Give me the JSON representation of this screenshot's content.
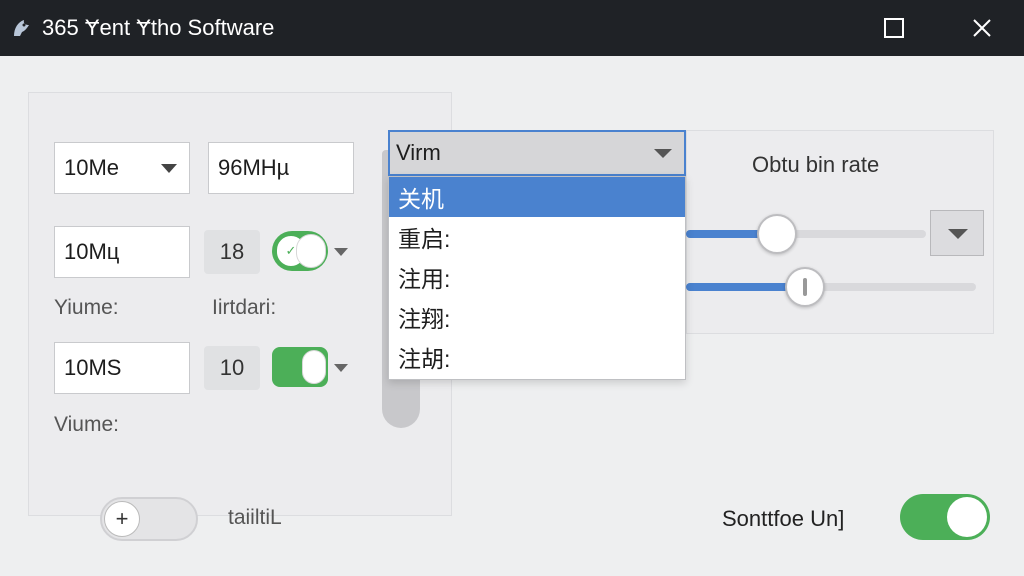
{
  "window": {
    "title": "365 Ɏent Ɏtho Software",
    "icon": "app-logo-icon",
    "maximize_icon": "maximize-icon",
    "close_icon": "close-icon"
  },
  "left_panel": {
    "row1": {
      "select_value": "10Me",
      "input_value": "96MHµ"
    },
    "row2": {
      "input_value": "10Mц",
      "badge": "18"
    },
    "row3": {
      "input_value": "10MS",
      "badge": "10"
    },
    "labels": {
      "volume1": "Yiume:",
      "interdari": "Iirtdari:",
      "volume2": "Viume:"
    }
  },
  "dropdown": {
    "selected_value": "Virm",
    "options": [
      "关机​",
      "重启:",
      "注用:",
      "注翔:",
      "注胡:"
    ],
    "highlighted_index": 0
  },
  "right_panel": {
    "label": "Obtu bin rate",
    "slider1_fraction": 0.38,
    "slider2_fraction": 0.41
  },
  "bottom": {
    "toggle_left_label": "taiiltiL",
    "toggle_right_label": "Sonttfoe Un]",
    "toggle_right_on": true
  },
  "colors": {
    "accent": "#4a82cf",
    "toggle_on": "#4caf58",
    "titlebar": "#1f2226"
  }
}
